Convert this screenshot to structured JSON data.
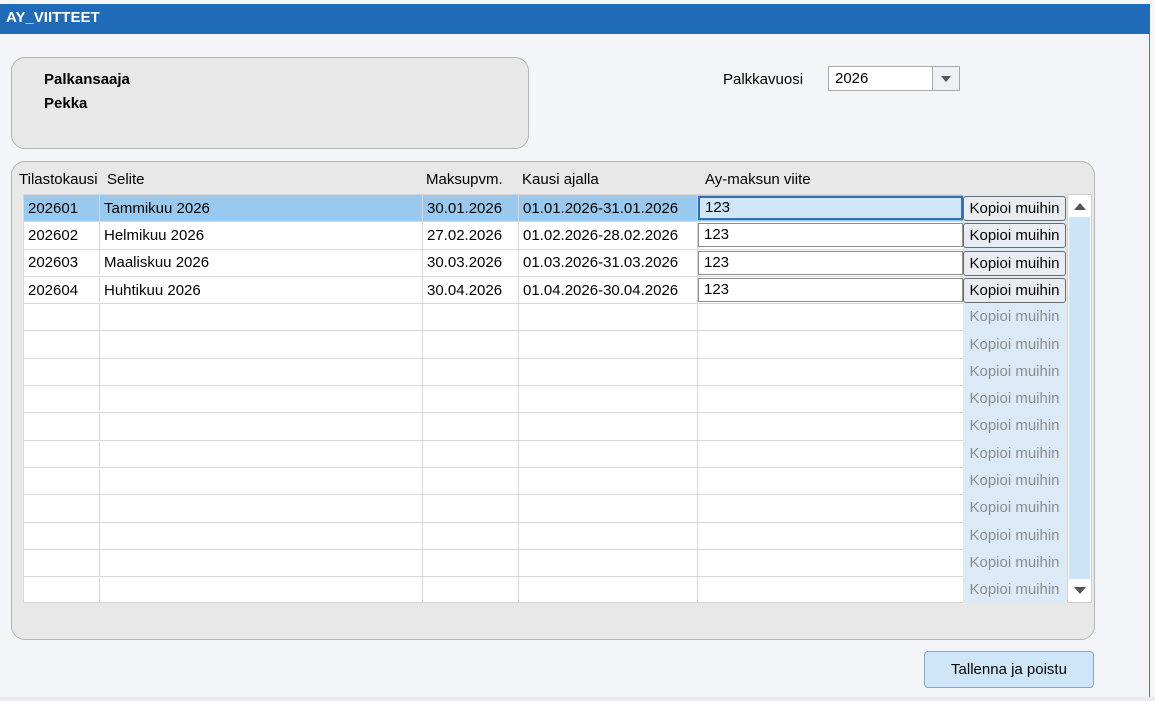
{
  "window": {
    "title": "AY_VIITTEET"
  },
  "employee": {
    "label": "Palkansaaja",
    "name": "Pekka"
  },
  "year": {
    "label": "Palkkavuosi",
    "value": "2026"
  },
  "grid": {
    "headers": {
      "tilastokausi": "Tilastokausi",
      "selite": "Selite",
      "maksupvm": "Maksupvm.",
      "kausi": "Kausi ajalla",
      "viite": "Ay-maksun viite"
    },
    "rows": [
      {
        "tilastokausi": "202601",
        "selite": "Tammikuu 2026",
        "maksupvm": "30.01.2026",
        "kausi": "01.01.2026-31.01.2026",
        "viite": "123",
        "selected": true
      },
      {
        "tilastokausi": "202602",
        "selite": "Helmikuu 2026",
        "maksupvm": "27.02.2026",
        "kausi": "01.02.2026-28.02.2026",
        "viite": "123",
        "selected": false
      },
      {
        "tilastokausi": "202603",
        "selite": "Maaliskuu 2026",
        "maksupvm": "30.03.2026",
        "kausi": "01.03.2026-31.03.2026",
        "viite": "123",
        "selected": false
      },
      {
        "tilastokausi": "202604",
        "selite": "Huhtikuu 2026",
        "maksupvm": "30.04.2026",
        "kausi": "01.04.2026-30.04.2026",
        "viite": "123",
        "selected": false
      }
    ],
    "empty_row_count": 11,
    "copy_button_label": "Kopioi muihin"
  },
  "footer": {
    "save_label": "Tallenna ja poistu"
  },
  "colors": {
    "titlebar": "#1f6bb8",
    "selected_row": "#99c9ef",
    "accent": "#2f6fb5"
  }
}
